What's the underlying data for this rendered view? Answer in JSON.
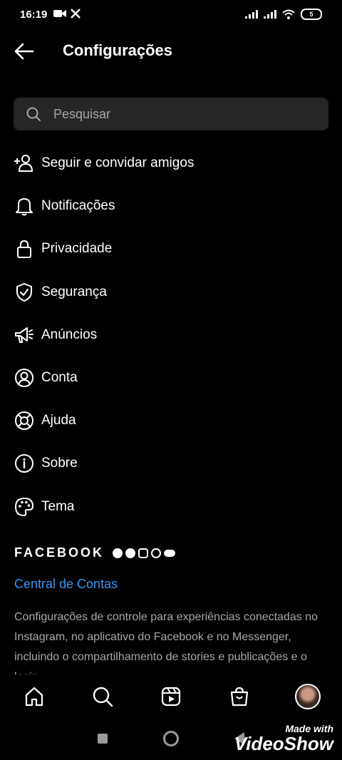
{
  "status_bar": {
    "time": "16:19",
    "battery": "5"
  },
  "header": {
    "title": "Configurações"
  },
  "search": {
    "placeholder": "Pesquisar"
  },
  "menu": [
    {
      "label": "Seguir e convidar amigos",
      "icon": "add-person-icon"
    },
    {
      "label": "Notificações",
      "icon": "bell-icon"
    },
    {
      "label": "Privacidade",
      "icon": "lock-icon"
    },
    {
      "label": "Segurança",
      "icon": "shield-icon"
    },
    {
      "label": "Anúncios",
      "icon": "megaphone-icon"
    },
    {
      "label": "Conta",
      "icon": "account-icon"
    },
    {
      "label": "Ajuda",
      "icon": "lifebuoy-icon"
    },
    {
      "label": "Sobre",
      "icon": "info-icon"
    },
    {
      "label": "Tema",
      "icon": "palette-icon"
    }
  ],
  "facebook": {
    "wordmark": "FACEBOOK",
    "central_link": "Central de Contas",
    "description": "Configurações de controle para experiências conectadas no Instagram, no aplicativo do Facebook e no Messenger, incluindo o compartilhamento de stories e publicações e o login."
  },
  "tabbar": [
    "home-icon",
    "search-icon",
    "reels-icon",
    "shop-icon",
    "profile-avatar"
  ],
  "watermark": {
    "line1": "Made with",
    "line2": "VideoShow"
  },
  "colors": {
    "background": "#000000",
    "search_bg": "#262626",
    "link": "#3897f0",
    "muted": "#a8a8a8"
  }
}
